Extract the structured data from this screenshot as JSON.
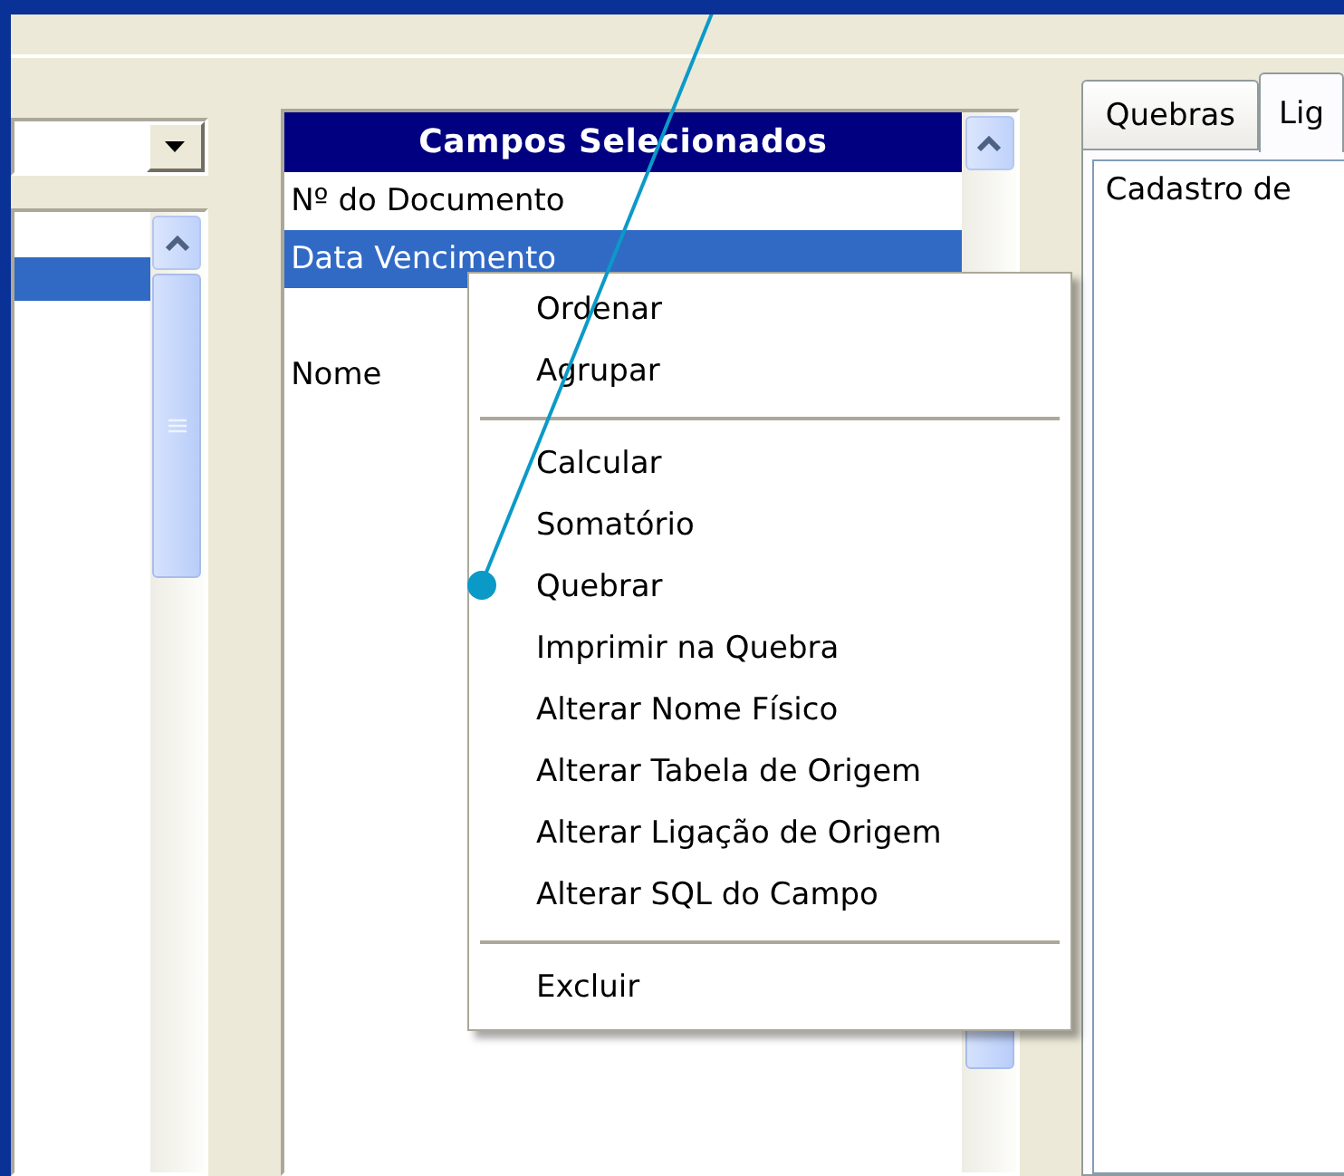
{
  "left_list": {
    "rows": [
      {
        "selected": true
      }
    ]
  },
  "selected_fields": {
    "title": "Campos Selecionados",
    "rows": [
      {
        "kind": "field",
        "label": "Nº do Documento",
        "selected": false
      },
      {
        "kind": "field",
        "label": "Data Vencimento",
        "selected": true
      },
      {
        "kind": "blank"
      },
      {
        "kind": "field",
        "label": "Nome",
        "selected": false
      }
    ]
  },
  "context_menu": {
    "items": [
      {
        "kind": "item",
        "label": "Ordenar"
      },
      {
        "kind": "item",
        "label": "Agrupar"
      },
      {
        "kind": "separator"
      },
      {
        "kind": "item",
        "label": "Calcular"
      },
      {
        "kind": "item",
        "label": "Somatório"
      },
      {
        "kind": "item",
        "label": "Quebrar"
      },
      {
        "kind": "item",
        "label": "Imprimir na Quebra"
      },
      {
        "kind": "item",
        "label": "Alterar Nome Físico"
      },
      {
        "kind": "item",
        "label": "Alterar Tabela de Origem"
      },
      {
        "kind": "item",
        "label": "Alterar Ligação de Origem"
      },
      {
        "kind": "item",
        "label": "Alterar SQL do Campo"
      },
      {
        "kind": "separator"
      },
      {
        "kind": "item",
        "label": "Excluir"
      }
    ]
  },
  "right_panel": {
    "tabs": [
      {
        "label": "Quebras",
        "selected": false
      },
      {
        "label": "Lig",
        "selected": true
      }
    ],
    "content": "Cadastro de"
  }
}
